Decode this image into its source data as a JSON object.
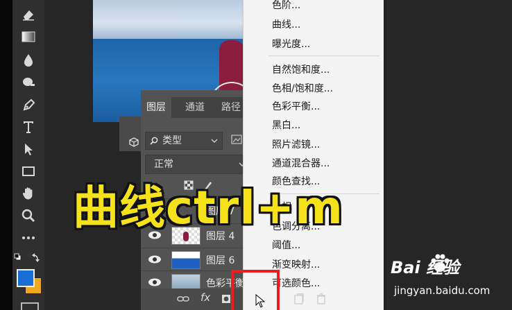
{
  "menu": {
    "items": [
      {
        "label": "色阶..."
      },
      {
        "label": "曲线..."
      },
      {
        "label": "曝光度..."
      },
      {
        "label": "自然饱和度..."
      },
      {
        "label": "色相/饱和度..."
      },
      {
        "label": "色彩平衡..."
      },
      {
        "label": "黑白..."
      },
      {
        "label": "照片滤镜..."
      },
      {
        "label": "通道混合器..."
      },
      {
        "label": "颜色查找..."
      },
      {
        "label": "反相"
      },
      {
        "label": "色调分离..."
      },
      {
        "label": "阈值..."
      },
      {
        "label": "渐变映射..."
      },
      {
        "label": "可选颜色..."
      }
    ]
  },
  "layers_panel": {
    "tabs": [
      {
        "label": "图层"
      },
      {
        "label": "通道"
      },
      {
        "label": "路径"
      }
    ],
    "filter_label": "类型",
    "filter_icon": "search-icon",
    "blend_mode": "正常",
    "layers": [
      {
        "name": "图层 7"
      },
      {
        "name": "图层 4"
      },
      {
        "name": "图层 6"
      },
      {
        "name": "色彩平衡"
      }
    ]
  },
  "overlay": {
    "caption": "曲线ctrl+m"
  },
  "watermark": {
    "brand": "Bai 经验",
    "url": "jingyan.baidu.com"
  },
  "colors": {
    "foreground": "#1a6fd6",
    "background": "#f0a820",
    "highlight_box": "#ee1c1c",
    "caption": "#f5e21a"
  }
}
